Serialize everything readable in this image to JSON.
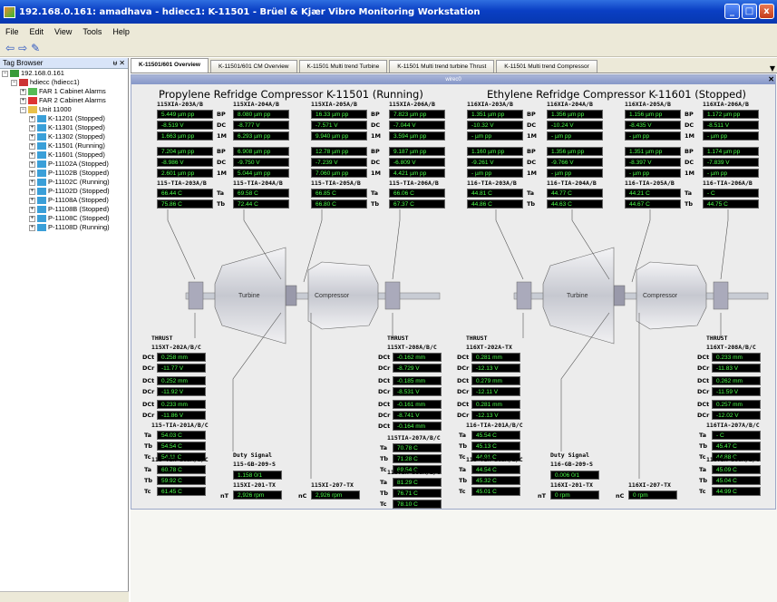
{
  "window": {
    "title": "192.168.0.161: amadhava - hdiecc1: K-11501 - Brüel & Kjær Vibro Monitoring Workstation",
    "buttons": [
      "_",
      "□",
      "x"
    ]
  },
  "menu": [
    "File",
    "Edit",
    "View",
    "Tools",
    "Help"
  ],
  "toolbar": {
    "icons": [
      "back-arrow-icon",
      "forward-arrow-icon",
      "edit-icon"
    ]
  },
  "tagBrowser": {
    "title": "Tag Browser",
    "pin": "ᵾ ✕",
    "items": [
      {
        "label": "192.168.0.161",
        "level": 0,
        "icon": "server"
      },
      {
        "label": "hdiecc (hdiecc1)",
        "level": 1,
        "icon": "db"
      },
      {
        "label": "FAR 1 Cabinet Alarms",
        "level": 2,
        "icon": "folder-green"
      },
      {
        "label": "FAR 2 Cabinet Alarms",
        "level": 2,
        "icon": "folder-red"
      },
      {
        "label": "Unit 11000",
        "level": 2,
        "icon": "folder"
      },
      {
        "label": "K-11201 (Stopped)",
        "level": 3,
        "icon": "machine"
      },
      {
        "label": "K-11301 (Stopped)",
        "level": 3,
        "icon": "machine"
      },
      {
        "label": "K-11302 (Stopped)",
        "level": 3,
        "icon": "machine"
      },
      {
        "label": "K-11501 (Running)",
        "level": 3,
        "icon": "machine"
      },
      {
        "label": "K-11601 (Stopped)",
        "level": 3,
        "icon": "machine"
      },
      {
        "label": "P-11102A (Stopped)",
        "level": 3,
        "icon": "machine"
      },
      {
        "label": "P-11102B (Stopped)",
        "level": 3,
        "icon": "machine"
      },
      {
        "label": "P-11102C (Running)",
        "level": 3,
        "icon": "machine"
      },
      {
        "label": "P-11102D (Stopped)",
        "level": 3,
        "icon": "machine"
      },
      {
        "label": "P-11108A (Stopped)",
        "level": 3,
        "icon": "machine"
      },
      {
        "label": "P-11108B (Stopped)",
        "level": 3,
        "icon": "machine"
      },
      {
        "label": "P-11108C (Stopped)",
        "level": 3,
        "icon": "machine"
      },
      {
        "label": "P-11108D (Running)",
        "level": 3,
        "icon": "machine"
      }
    ]
  },
  "tabs": [
    "K-11501/601 Overview",
    "K-11501/601 CM Overview",
    "K-11501 Multi trend Turbine",
    "K-11501 Multi trend turbine Thrust",
    "K-11501 Multi trend Compressor"
  ],
  "dashboard": {
    "header": "wirec0",
    "titles": {
      "left": "Propylene Refridge Compressor K-11501 (Running)",
      "right": "Ethylene Refridge Compressor K-11601 (Stopped)"
    },
    "rowLabels": [
      "BP",
      "DC",
      "1M",
      "BP",
      "DC",
      "1M"
    ],
    "top": [
      {
        "name": "115XIA-203A/B",
        "vals": [
          "5.449 µm pp",
          "-8.519 V",
          "1.663 µm pp",
          "7.204 µm pp",
          "-8.986 V",
          "2.601 µm pp"
        ]
      },
      {
        "name": "115XIA-204A/B",
        "vals": [
          "8.080 µm pp",
          "-8.777 V",
          "6.293 µm pp",
          "6.908 µm pp",
          "-9.750 V",
          "5.044 µm pp"
        ]
      },
      {
        "name": "115XIA-205A/B",
        "vals": [
          "16.33 µm pp",
          "-7.571 V",
          "9.940 µm pp",
          "12.78 µm pp",
          "-7.239 V",
          "7.060 µm pp"
        ]
      },
      {
        "name": "115XIA-206A/B",
        "vals": [
          "7.823 µm pp",
          "-7.044 V",
          "3.594 µm pp",
          "9.187 µm pp",
          "-6.809 V",
          "4.421 µm pp"
        ]
      },
      {
        "name": "116XIA-203A/B",
        "vals": [
          "1.351 µm pp",
          "-10.32 V",
          "- µm pp",
          "1.160 µm pp",
          "-9.261 V",
          "- µm pp"
        ]
      },
      {
        "name": "116XIA-204A/B",
        "vals": [
          "1.356 µm pp",
          "-10.24 V",
          "- µm pp",
          "1.356 µm pp",
          "-9.766 V",
          "- µm pp"
        ]
      },
      {
        "name": "116XIA-205A/B",
        "vals": [
          "1.156 µm pp",
          "-8.435 V",
          "- µm pp",
          "1.351 µm pp",
          "-8.397 V",
          "- µm pp"
        ]
      },
      {
        "name": "116XIA-206A/B",
        "vals": [
          "1.172 µm pp",
          "-8.511 V",
          "- µm pp",
          "1.174 µm pp",
          "-7.839 V",
          "- µm pp"
        ]
      }
    ],
    "temps": [
      {
        "name": "115-TIA-203A/B",
        "vals": [
          "66.44 C",
          "75.86 C"
        ]
      },
      {
        "name": "115-TIA-204A/B",
        "vals": [
          "69.58 C",
          "72.44 C"
        ]
      },
      {
        "name": "115-TIA-205A/B",
        "vals": [
          "66.85 C",
          "66.80 C"
        ]
      },
      {
        "name": "115-TIA-206A/B",
        "vals": [
          "66.06 C",
          "67.37 C"
        ]
      },
      {
        "name": "116-TIA-203A/B",
        "vals": [
          "44.81 C",
          "44.86 C"
        ]
      },
      {
        "name": "116-TIA-204A/B",
        "vals": [
          "44.77 C",
          "44.63 C"
        ]
      },
      {
        "name": "116-TIA-205A/B",
        "vals": [
          "44.21 C",
          "44.67 C"
        ]
      },
      {
        "name": "116-TIA-206A/B",
        "vals": [
          "- C",
          "44.75 C"
        ]
      }
    ],
    "tempLabels": [
      "Ta",
      "Tb"
    ],
    "machines": {
      "turbine": "Turbine",
      "compressor": "Compressor"
    },
    "thrust": [
      {
        "head": "THRUST",
        "name": "115XT-202A/B/C",
        "vals": [
          "0.258 mm",
          "-11.77 V",
          "0.252 mm",
          "-11.92 V",
          "0.233 mm",
          "-11.86 V"
        ]
      },
      {
        "head": "THRUST",
        "name": "115XT-208A/B/C",
        "vals": [
          "-0.162 mm",
          "-8.729 V",
          "-0.185 mm",
          "-8.531 V",
          "-0.161 mm",
          "-8.741 V",
          "-0.164 mm"
        ]
      },
      {
        "head": "THRUST",
        "name": "116XT-202A-TX",
        "vals": [
          "0.281 mm",
          "-12.13 V",
          "0.279 mm",
          "-12.11 V",
          "0.281 mm",
          "-12.13 V"
        ]
      },
      {
        "head": "THRUST",
        "name": "116XT-208A/B/C",
        "vals": [
          "0.233 mm",
          "-11.83 V",
          "0.262 mm",
          "-11.59 V",
          "0.257 mm",
          "-12.02 V"
        ]
      }
    ],
    "thrustLabels": [
      "DCt",
      "DCr",
      "DCt",
      "DCr",
      "DCt",
      "DCr",
      "DCt"
    ],
    "bottomTemps": [
      {
        "name": "115-TIA-201A/B/C",
        "vals": [
          "54.03 C",
          "54.54 C",
          "54.11 C"
        ]
      },
      {
        "name": "115-TIA-202A/B/C",
        "vals": [
          "60.78 C",
          "59.92 C",
          "61.45 C"
        ]
      },
      {
        "name": "115TIA-207A/B/C",
        "vals": [
          "70.78 C",
          "71.28 C",
          "69.54 C"
        ]
      },
      {
        "name": "115TIA-208A/B/C",
        "vals": [
          "81.29 C",
          "76.71 C",
          "78.10 C"
        ]
      },
      {
        "name": "116-TIA-201A/B/C",
        "vals": [
          "45.54 C",
          "45.13 C",
          "44.91 C"
        ]
      },
      {
        "name": "116-TIA-202A/B/C",
        "vals": [
          "44.54 C",
          "45.32 C",
          "45.01 C"
        ]
      },
      {
        "name": "116TIA-207A/B/C",
        "vals": [
          "- C",
          "45.47 C",
          "44.88 C"
        ]
      },
      {
        "name": "116TIA-208A/B/C",
        "vals": [
          "45.09 C",
          "45.04 C",
          "44.99 C"
        ]
      }
    ],
    "btLabels": [
      "Ta",
      "Tb",
      "Tc"
    ],
    "duty": [
      {
        "head": "Duty Signal",
        "name": "115-GB-209-S",
        "val": "1.158 0/1"
      },
      {
        "head": "Duty Signal",
        "name": "116-GB-209-S",
        "val": "0.006 0/1"
      }
    ],
    "speed": [
      {
        "name": "115XI-201-TX",
        "val": "2,926 rpm",
        "pre": "nT"
      },
      {
        "name": "115XI-207-TX",
        "val": "2,926 rpm",
        "pre": "nC"
      },
      {
        "name": "116XI-201-TX",
        "val": "0 rpm",
        "pre": "nT"
      },
      {
        "name": "116XI-207-TX",
        "val": "0 rpm",
        "pre": "nC"
      }
    ]
  }
}
